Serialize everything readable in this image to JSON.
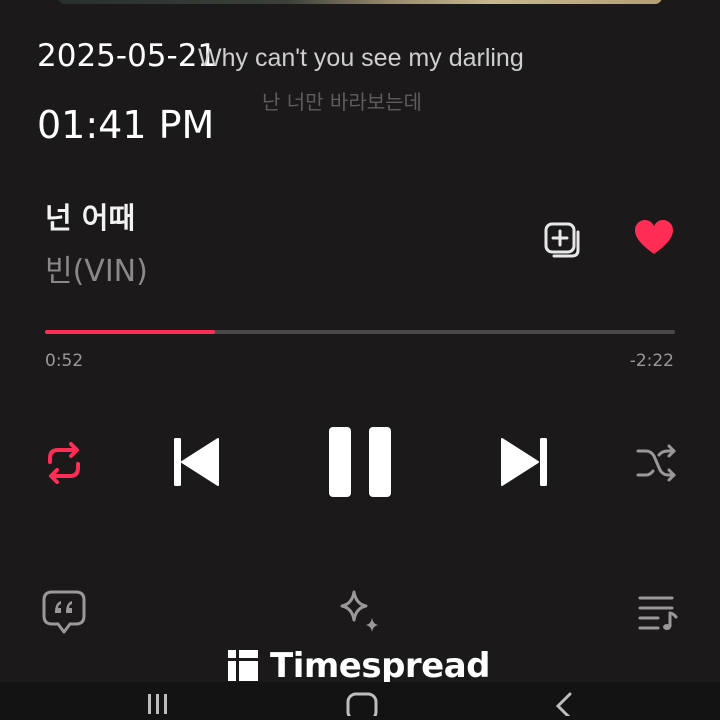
{
  "overlay": {
    "date": "2025-05-21",
    "time": "01:41 PM"
  },
  "lyrics": {
    "current_line": "Why can't you see my darling",
    "next_line": "난 너만 바라보는데"
  },
  "track": {
    "title": "넌 어때",
    "artist": "빈(VIN)",
    "liked": true
  },
  "playback": {
    "elapsed": "0:52",
    "remaining": "-2:22",
    "progress_fraction": 0.27,
    "state": "playing",
    "repeat_active": true
  },
  "controls": {
    "icons": [
      "repeat-icon",
      "previous-icon",
      "pause-icon",
      "next-icon",
      "shuffle-icon"
    ]
  },
  "bottom_bar": {
    "icons": [
      "lyrics-icon",
      "sparkle-icon",
      "queue-icon"
    ]
  },
  "watermark": {
    "text": "Timespread"
  },
  "colors": {
    "accent": "#ff2d55",
    "background": "#1b1919",
    "muted_text": "#8a8888",
    "icon_gray": "#9a9898"
  }
}
